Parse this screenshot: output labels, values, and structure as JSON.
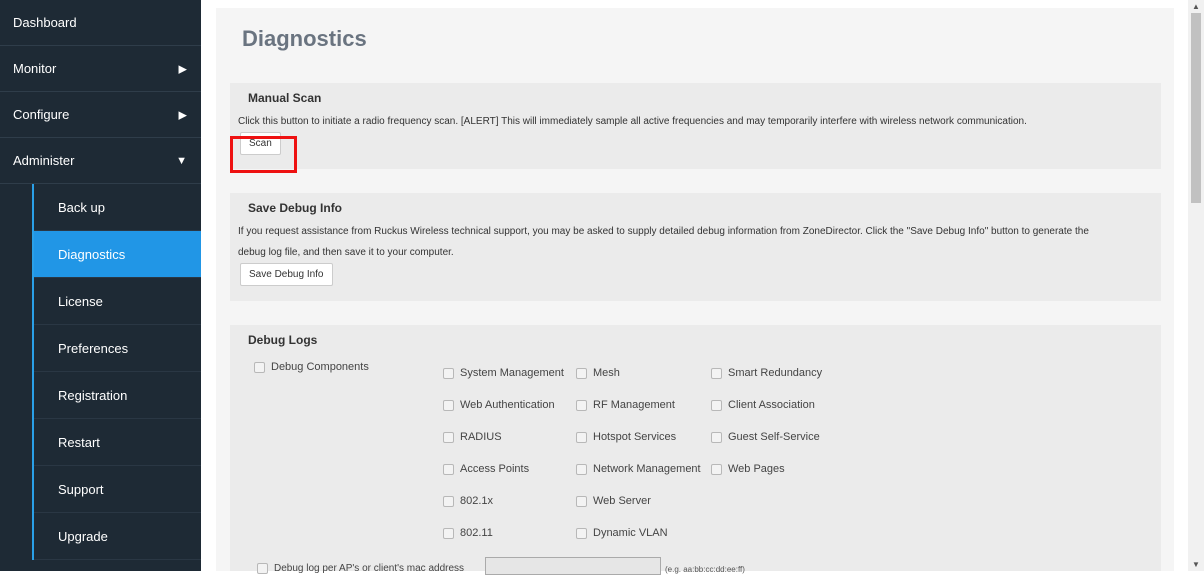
{
  "sidebar": {
    "top_items": [
      {
        "label": "Dashboard"
      },
      {
        "label": "Monitor"
      },
      {
        "label": "Configure"
      },
      {
        "label": "Administer"
      }
    ],
    "sub_items": [
      {
        "label": "Back up"
      },
      {
        "label": "Diagnostics"
      },
      {
        "label": "License"
      },
      {
        "label": "Preferences"
      },
      {
        "label": "Registration"
      },
      {
        "label": "Restart"
      },
      {
        "label": "Support"
      },
      {
        "label": "Upgrade"
      }
    ],
    "active_item": "Diagnostics",
    "icons": {
      "expand": "▶",
      "collapse": "▼"
    }
  },
  "main": {
    "title": "Diagnostics",
    "manual_scan": {
      "heading": "Manual Scan",
      "description": "Click this button to initiate a radio frequency scan. [ALERT] This will immediately sample all active frequencies and may temporarily interfere with wireless network communication.",
      "button": "Scan"
    },
    "save_debug": {
      "heading": "Save Debug Info",
      "description_line1": "If you request assistance from Ruckus Wireless technical support, you may be asked to supply detailed debug information from ZoneDirector. Click the \"Save Debug Info\" button to generate the",
      "description_line2": "debug log file, and then save it to your computer.",
      "button": "Save Debug Info"
    },
    "debug_logs": {
      "heading": "Debug Logs",
      "debug_components": "Debug Components",
      "col1": [
        "System Management",
        "Web Authentication",
        "RADIUS",
        "Access Points",
        "802.1x",
        "802.11"
      ],
      "col2": [
        "Mesh",
        "RF Management",
        "Hotspot Services",
        "Network Management",
        "Web Server",
        "Dynamic VLAN"
      ],
      "col3": [
        "Smart Redundancy",
        "Client Association",
        "Guest Self-Service",
        "Web Pages"
      ],
      "per_mac_label": "Debug log per AP's or client's mac address",
      "mac_hint": "(e.g. aa:bb:cc:dd:ee:ff)",
      "mac_value": ""
    }
  },
  "colors": {
    "sidebar_bg": "#1e2a35",
    "active_bg": "#2196e6",
    "accent_line": "#2aa0e8",
    "highlight": "#e11111"
  }
}
